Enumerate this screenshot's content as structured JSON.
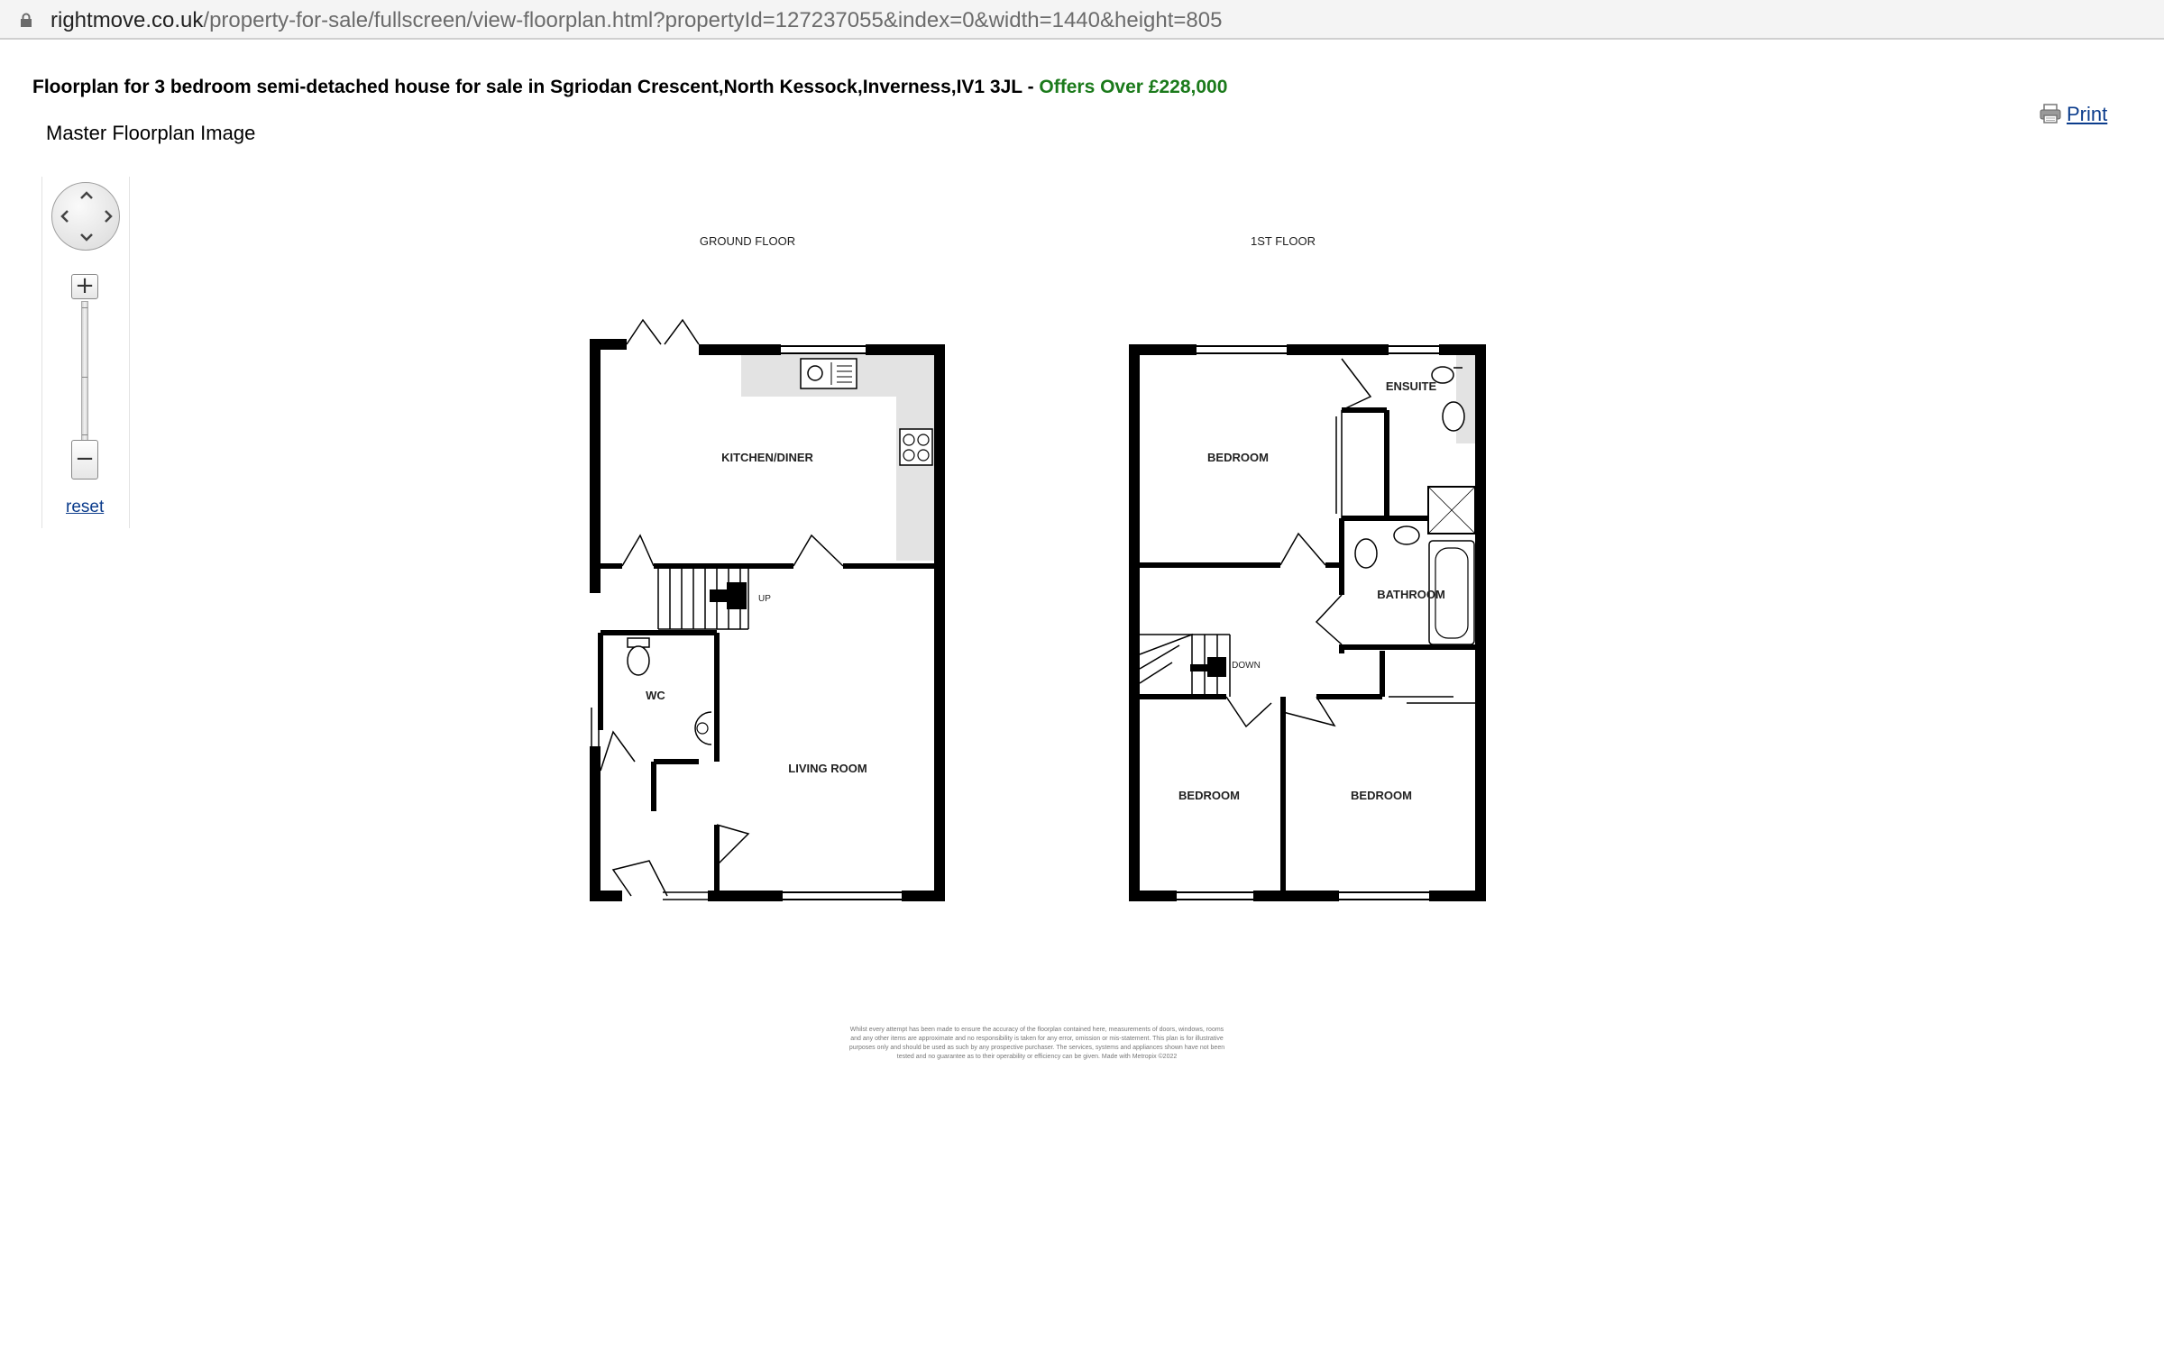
{
  "browser": {
    "url_domain": "rightmove.co.uk",
    "url_path": "/property-for-sale/fullscreen/view-floorplan.html?propertyId=127237055&index=0&width=1440&height=805"
  },
  "header": {
    "title_text": "Floorplan for 3 bedroom semi-detached house for sale in Sgriodan Crescent,North Kessock,Inverness,IV1 3JL - ",
    "price_text": "Offers Over £228,000",
    "price_color": "#1b7a1b",
    "subtitle": "Master Floorplan Image",
    "print_label": "Print"
  },
  "controls": {
    "zoom_in_label": "+",
    "zoom_out_label": "−",
    "reset_label": "reset",
    "icons": [
      "lock-icon",
      "pan-control-icon",
      "printer-icon"
    ]
  },
  "floorplan": {
    "ground_floor_label": "GROUND FLOOR",
    "first_floor_label": "1ST FLOOR",
    "rooms": {
      "kitchen": "KITCHEN/DINER",
      "living": "LIVING ROOM",
      "wc": "WC",
      "bedroom_master": "BEDROOM",
      "ensuite": "ENSUITE",
      "bathroom": "BATHROOM",
      "bedroom_2": "BEDROOM",
      "bedroom_3": "BEDROOM"
    },
    "stairs_up": "UP",
    "stairs_down": "DOWN",
    "disclaimer": "Whilst every attempt has been made to ensure the accuracy of the floorplan contained here, measurements of doors, windows, rooms and any other items are approximate and no responsibility is taken for any error, omission or mis-statement. This plan is for illustrative purposes only and should be used as such by any prospective purchaser. The services, systems and appliances shown have not been tested and no guarantee as to their operability or efficiency can be given. Made with Metropix ©2022"
  }
}
